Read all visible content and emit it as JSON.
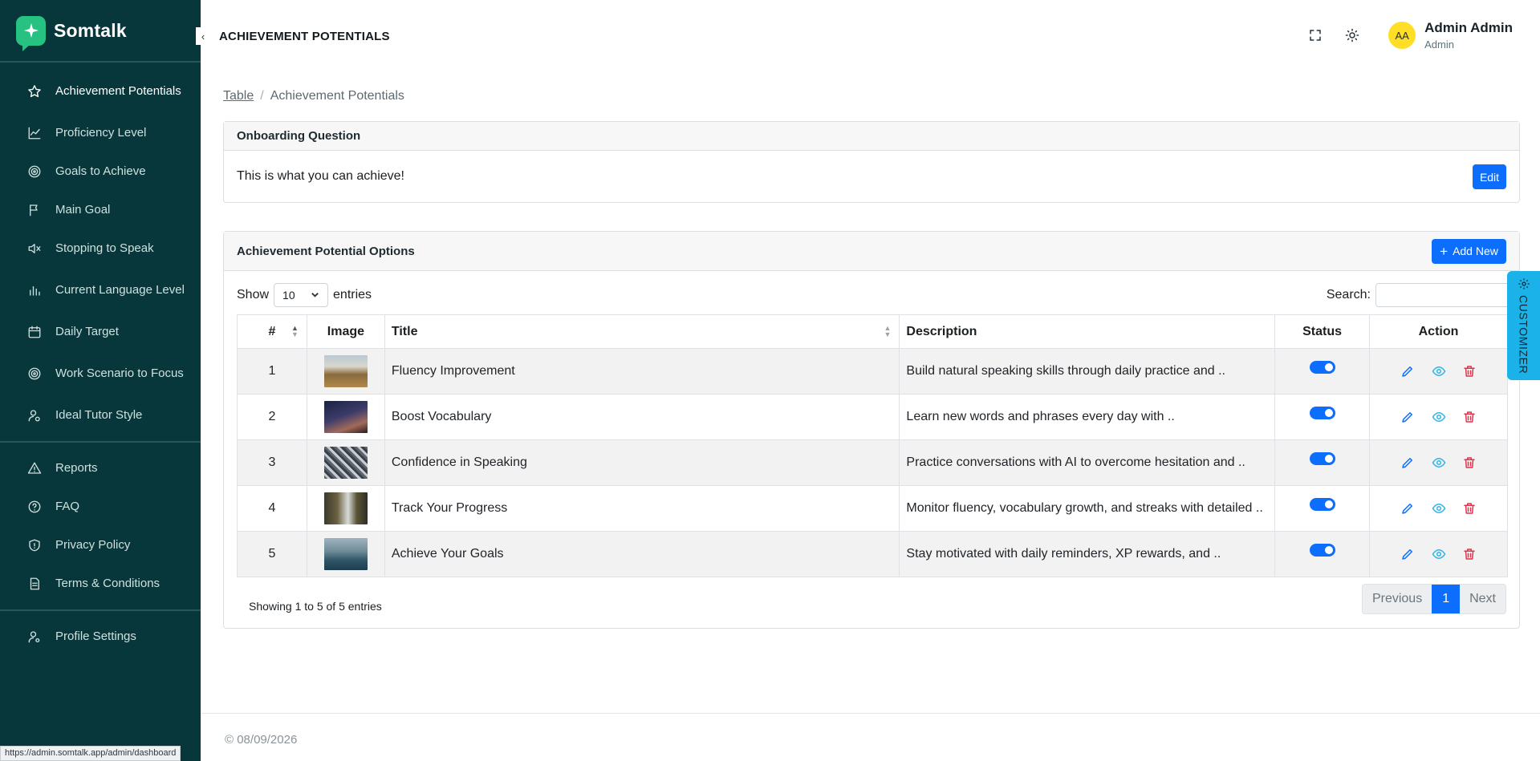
{
  "app": {
    "brand": "Somtalk",
    "status_url": "https://admin.somtalk.app/admin/dashboard",
    "accent_color": "#0d6efd",
    "sidebar_color": "#07373a"
  },
  "sidebar": {
    "groups": [
      [
        {
          "label": "Achievement Potentials",
          "icon": "star-icon",
          "active": true
        },
        {
          "label": "Proficiency Level",
          "icon": "chart-line-icon"
        },
        {
          "label": "Goals to Achieve",
          "icon": "target-icon"
        },
        {
          "label": "Main Goal",
          "icon": "flag-icon"
        },
        {
          "label": "Stopping to Speak",
          "icon": "mute-icon"
        },
        {
          "label": "Current Language Level",
          "icon": "bar-chart-icon"
        },
        {
          "label": "Daily Target",
          "icon": "calendar-icon"
        },
        {
          "label": "Work Scenario to Focus",
          "icon": "target-icon"
        },
        {
          "label": "Ideal Tutor Style",
          "icon": "user-icon"
        }
      ],
      [
        {
          "label": "Reports",
          "icon": "warning-icon"
        },
        {
          "label": "FAQ",
          "icon": "help-circle-icon"
        },
        {
          "label": "Privacy Policy",
          "icon": "shield-icon"
        },
        {
          "label": "Terms & Conditions",
          "icon": "document-icon"
        }
      ],
      [
        {
          "label": "Profile Settings",
          "icon": "user-settings-icon"
        }
      ]
    ]
  },
  "header": {
    "collapse_glyph": "‹",
    "title": "ACHIEVEMENT POTENTIALS",
    "user": {
      "initials": "AA",
      "name": "Admin Admin",
      "role": "Admin"
    }
  },
  "breadcrumb": {
    "link": "Table",
    "separator": "/",
    "current": "Achievement Potentials"
  },
  "onboarding": {
    "header": "Onboarding Question",
    "text": "This is what you can achieve!",
    "edit_label": "Edit"
  },
  "options": {
    "header": "Achievement Potential Options",
    "add_plus": "+",
    "add_label": "Add New",
    "show_label": "Show",
    "page_length": "10",
    "entries_label": "entries",
    "search_label": "Search:",
    "search_value": "",
    "columns": {
      "num": "#",
      "image": "Image",
      "title": "Title",
      "description": "Description",
      "status": "Status",
      "action": "Action"
    },
    "rows": [
      {
        "num": "1",
        "title": "Fluency Improvement",
        "description": "Build natural speaking skills through daily practice and ..",
        "active": true
      },
      {
        "num": "2",
        "title": "Boost Vocabulary",
        "description": "Learn new words and phrases every day with ..",
        "active": true
      },
      {
        "num": "3",
        "title": "Confidence in Speaking",
        "description": "Practice conversations with AI to overcome hesitation and ..",
        "active": true
      },
      {
        "num": "4",
        "title": "Track Your Progress",
        "description": "Monitor fluency, vocabulary growth, and streaks with detailed ..",
        "active": true
      },
      {
        "num": "5",
        "title": "Achieve Your Goals",
        "description": "Stay motivated with daily reminders, XP rewards, and ..",
        "active": true
      }
    ],
    "info": "Showing 1 to 5 of 5 entries",
    "pagination": {
      "previous": "Previous",
      "current": "1",
      "next": "Next"
    }
  },
  "footer": {
    "text": "© 08/09/2026"
  },
  "customizer": {
    "label": "CUSTOMIZER"
  }
}
